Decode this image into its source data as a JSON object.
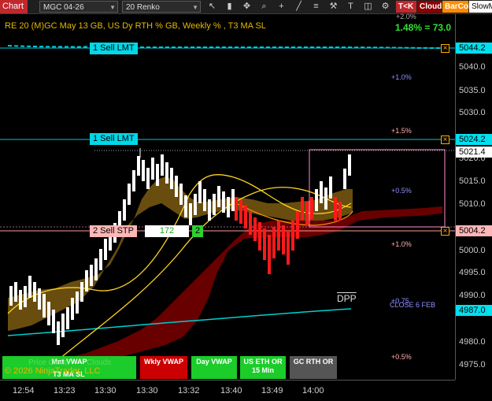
{
  "toolbar": {
    "app_tag": "Chart",
    "instrument": "MGC 04-26",
    "bar_type": "20 Renko",
    "buttons": {
      "tk": "T<K",
      "cloud": "Cloud",
      "barcol": "BarCol",
      "slow": "SlowM"
    }
  },
  "chart": {
    "title": "RE 20  (M)GC May 13 GB, US Dy RTH % GB, Weekly % , T3 MA SL",
    "stat": "1.48% = 73.0",
    "copyright": "© 2026 NinjaTrader, LLC",
    "dpp_label": "DPP",
    "close_label": "CLOSE 6 FEB",
    "overlay_label_1": "Price Cloud",
    "overlay_label_2": "Clouds",
    "overlay_label_3": "T3 MA SL"
  },
  "orders": [
    {
      "label": "1 Sell LMT",
      "price": "5044.2"
    },
    {
      "label": "1 Sell LMT",
      "price": "5024.2"
    },
    {
      "label": "2 Sell STP",
      "qty": "172",
      "count": "2",
      "price": "5004.2"
    }
  ],
  "pct_levels": [
    "+2.0%",
    "+1.0%",
    "+1.5%",
    "+0.5%",
    "+1.0%",
    "+0.75",
    "+0.5%"
  ],
  "price_axis": {
    "ticks": [
      "5040.0",
      "5035.0",
      "5030.0",
      "5020.0",
      "5015.0",
      "5010.0",
      "5000.0",
      "4995.0",
      "4990.0",
      "4980.0",
      "4975.0"
    ],
    "last_price": "5021.4",
    "close_price": "4987.0"
  },
  "time_axis": [
    "12:54",
    "13:23",
    "13:30",
    "13:30",
    "13:32",
    "13:40",
    "13:49",
    "14:00"
  ],
  "vwap_buttons": [
    "Mnt VWAP",
    "Wkly VWAP",
    "Day VWAP",
    "US ETH OR 15 Min",
    "GC RTH OR"
  ],
  "colors": {
    "limit_line": "#00c8d8",
    "stop_line": "#ff9a9a",
    "title": "#e6b800",
    "up_brick": "#ffffff",
    "down_brick": "#ff1a1a",
    "cloud_gold": "#7a5a10",
    "cloud_red": "#7a0000",
    "ma_yellow": "#ffd21f"
  },
  "chart_data": {
    "type": "line",
    "title": "RE 20  (M)GC May 13 GB, US Dy RTH % GB, Weekly % , T3 MA SL",
    "y_range": [
      4972,
      5048
    ],
    "x_ticks": [
      "12:54",
      "13:23",
      "13:30",
      "13:30",
      "13:32",
      "13:40",
      "13:49",
      "14:00"
    ],
    "series": [
      {
        "values": [
          4986,
          4990,
          4988,
          4986,
          4984,
          4988,
          4992,
          4996,
          5002,
          5008,
          5012,
          5018,
          5022,
          5020,
          5018,
          5016,
          5014,
          5012,
          5010,
          5012,
          5014,
          5012,
          5010,
          5008,
          5005,
          5002,
          5000,
          4998,
          4996,
          4998,
          5000,
          5002,
          5005,
          5008,
          5012,
          5015,
          5013,
          5011,
          5014,
          5018,
          5022
        ]
      }
    ]
  }
}
